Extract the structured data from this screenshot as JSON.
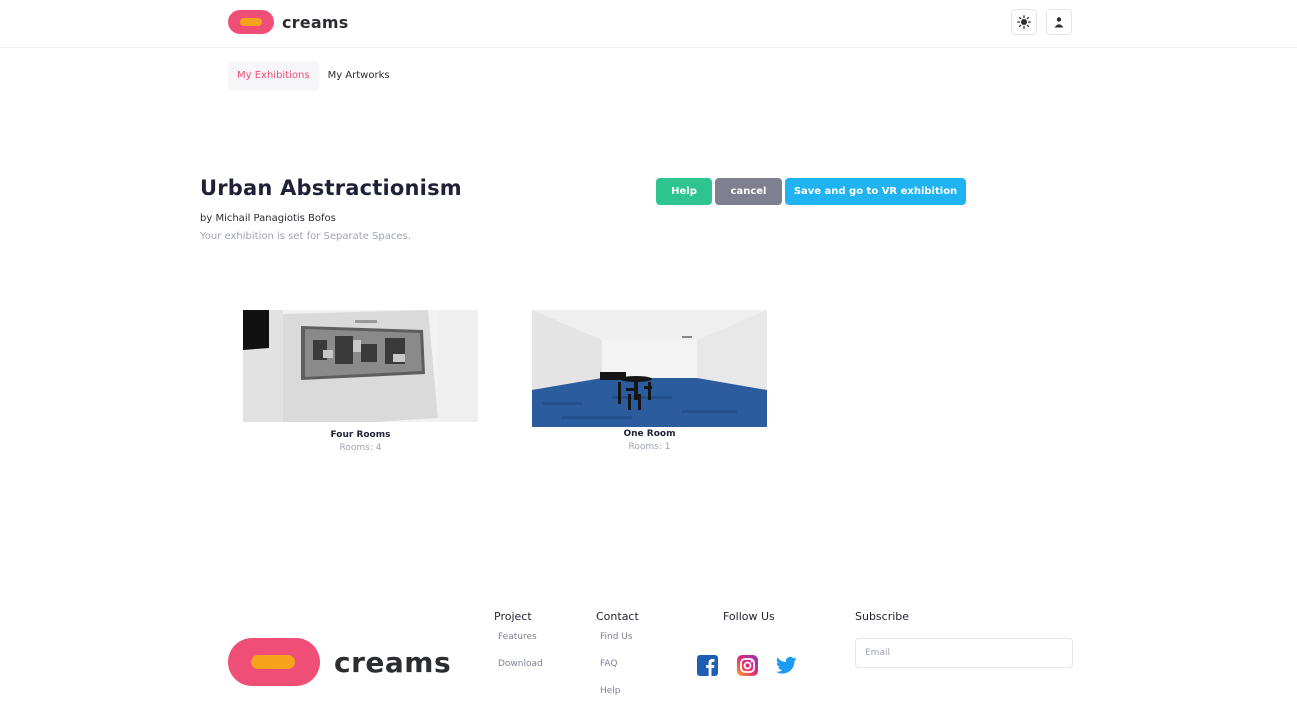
{
  "header": {
    "brand": "creams",
    "theme_icon": "sun-icon",
    "user_icon": "user-icon"
  },
  "tabs": [
    {
      "label": "My Exhibitions",
      "active": true
    },
    {
      "label": "My Artworks",
      "active": false
    }
  ],
  "exhibition": {
    "title": "Urban Abstractionism",
    "author": "by Michail Panagiotis Bofos",
    "note": "Your exhibition is set for Separate Spaces."
  },
  "actions": {
    "help": "Help",
    "cancel": "cancel",
    "save": "Save and go to VR exhibition"
  },
  "rooms": [
    {
      "name": "Four Rooms",
      "count": "Rooms: 4"
    },
    {
      "name": "One Room",
      "count": "Rooms: 1"
    }
  ],
  "footer": {
    "brand": "creams",
    "project": {
      "heading": "Project",
      "links": [
        "Features",
        "Download"
      ]
    },
    "contact": {
      "heading": "Contact",
      "links": [
        "Find Us",
        "FAQ",
        "Help"
      ]
    },
    "follow": {
      "heading": "Follow Us",
      "icons": [
        "facebook-icon",
        "instagram-icon",
        "twitter-icon"
      ]
    },
    "subscribe": {
      "heading": "Subscribe",
      "placeholder": "Email"
    }
  },
  "colors": {
    "accent": "#ef4f76",
    "brand_orange": "#f7a21b",
    "help": "#2dc48f",
    "cancel": "#7e7f91",
    "save": "#1fb3f1"
  }
}
